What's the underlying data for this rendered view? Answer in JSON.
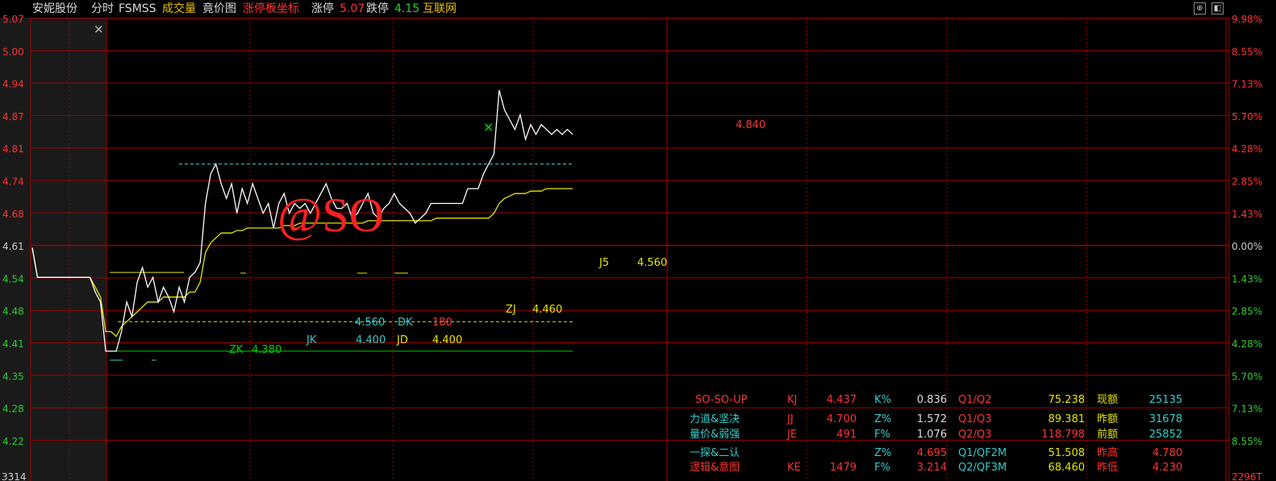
{
  "header": {
    "stock_name": "安妮股份",
    "mode": "分时",
    "indicator": "FSMSS",
    "volume": "成交量",
    "auction": "竟价图",
    "limit_axis": "涨停板坐标",
    "limit_up_label": "涨停",
    "limit_up_value": "5.07",
    "limit_down_label": "跌停",
    "limit_down_value": "4.15",
    "source": "互联网"
  },
  "colors": {
    "up": "#ff3333",
    "down": "#33cc33",
    "grid": "#a00000",
    "price_line": "#ffffff",
    "avg_line": "#e6e600",
    "cyan": "#33cccc",
    "yellow": "#e6e600",
    "green": "#00dd00"
  },
  "left_axis": [
    "5.07",
    "5.00",
    "4.94",
    "4.87",
    "4.81",
    "4.74",
    "4.68",
    "4.61",
    "4.54",
    "4.48",
    "4.41",
    "4.35",
    "4.28",
    "4.22"
  ],
  "right_axis": [
    "9.98%",
    "8.55%",
    "7.13%",
    "5.70%",
    "4.28%",
    "2.85%",
    "1.43%",
    "0.00%",
    "1.43%",
    "2.85%",
    "4.28%",
    "5.70%",
    "7.13%",
    "8.55%"
  ],
  "bottom_left_value": "3314",
  "bottom_right_value": "2296T",
  "watermark": "@SO",
  "annotations": {
    "price_mark": "4.840",
    "j5": "J5",
    "j5_value": "4.560",
    "zj": "ZJ",
    "zj_value": "4.460",
    "dk_left": "4.560",
    "dk": "DK",
    "dk_value": "180",
    "jk": "JK",
    "jk_value": "4.400",
    "jd": "JD",
    "jd_value": "4.400",
    "zk": "ZK",
    "zk_value": "4.380",
    "close_x": "×"
  },
  "stats": {
    "rows": [
      {
        "name": "SO-SO-UP",
        "k1": "KJ",
        "v1": "4.437",
        "k2": "K%",
        "v2": "0.836",
        "k3": "Q1/Q2",
        "v3": "75.238",
        "k4": "现额",
        "v4": "25135"
      },
      {
        "name": "力道&坚决",
        "k1": "JJ",
        "v1": "4.700",
        "k2": "Z%",
        "v2": "1.572",
        "k3": "Q1/Q3",
        "v3": "89.381",
        "k4": "昨额",
        "v4": "31678"
      },
      {
        "name": "量价&弱强",
        "k1": "JE",
        "v1": "491",
        "k2": "F%",
        "v2": "1.076",
        "k3": "Q2/Q3",
        "v3": "118.798",
        "k4": "前额",
        "v4": "25852"
      },
      {
        "name": "一探&二认",
        "k1": "",
        "v1": "",
        "k2": "Z%",
        "v2": "4.695",
        "k3": "Q1/QF2M",
        "v3": "51.508",
        "k4": "昨高",
        "v4": "4.780"
      },
      {
        "name": "逻辑&意图",
        "k1": "KE",
        "v1": "1479",
        "k2": "F%",
        "v2": "3.214",
        "k3": "Q2/QF3M",
        "v3": "68.460",
        "k4": "昨低",
        "v4": "4.230"
      }
    ]
  },
  "chart_data": {
    "type": "line",
    "series": [
      {
        "values": [
          4.61,
          4.55,
          4.55,
          4.55,
          4.55,
          4.55,
          4.55,
          4.55,
          4.55,
          4.55,
          4.55,
          4.55,
          4.52,
          4.5,
          4.4,
          4.4,
          4.4,
          4.44,
          4.5,
          4.47,
          4.54,
          4.57,
          4.53,
          4.55,
          4.5,
          4.53,
          4.51,
          4.48,
          4.53,
          4.5,
          4.55,
          4.56,
          4.58,
          4.7,
          4.76,
          4.78,
          4.74,
          4.71,
          4.74,
          4.68,
          4.73,
          4.7,
          4.74,
          4.71,
          4.68,
          4.7,
          4.65,
          4.7,
          4.72,
          4.68,
          4.7,
          4.69,
          4.7,
          4.68,
          4.7,
          4.72,
          4.74,
          4.71,
          4.69,
          4.69,
          4.7,
          4.67,
          4.68,
          4.7,
          4.72,
          4.68,
          4.67,
          4.69,
          4.7,
          4.72,
          4.7,
          4.69,
          4.68,
          4.66,
          4.67,
          4.68,
          4.7,
          4.7,
          4.7,
          4.7,
          4.7,
          4.7,
          4.7,
          4.73,
          4.73,
          4.73,
          4.76,
          4.78,
          4.8,
          4.93,
          4.89,
          4.87,
          4.85,
          4.88,
          4.83,
          4.86,
          4.84,
          4.86,
          4.85,
          4.84,
          4.85,
          4.84,
          4.85,
          4.84
        ]
      },
      {
        "values": [
          4.61,
          4.55,
          4.55,
          4.55,
          4.55,
          4.55,
          4.55,
          4.55,
          4.55,
          4.55,
          4.55,
          4.55,
          4.53,
          4.51,
          4.44,
          4.44,
          4.43,
          4.45,
          4.46,
          4.47,
          4.48,
          4.49,
          4.5,
          4.5,
          4.5,
          4.51,
          4.51,
          4.51,
          4.51,
          4.51,
          4.52,
          4.52,
          4.54,
          4.6,
          4.62,
          4.63,
          4.64,
          4.64,
          4.64,
          4.645,
          4.645,
          4.65,
          4.65,
          4.65,
          4.65,
          4.65,
          4.65,
          4.65,
          4.655,
          4.655,
          4.655,
          4.66,
          4.66,
          4.66,
          4.66,
          4.66,
          4.66,
          4.66,
          4.66,
          4.66,
          4.66,
          4.66,
          4.66,
          4.66,
          4.665,
          4.665,
          4.665,
          4.665,
          4.665,
          4.665,
          4.665,
          4.665,
          4.665,
          4.665,
          4.665,
          4.665,
          4.665,
          4.67,
          4.67,
          4.67,
          4.67,
          4.67,
          4.67,
          4.67,
          4.67,
          4.67,
          4.67,
          4.67,
          4.68,
          4.7,
          4.71,
          4.715,
          4.72,
          4.72,
          4.72,
          4.725,
          4.725,
          4.725,
          4.73,
          4.73,
          4.73,
          4.73,
          4.73,
          4.73
        ]
      }
    ],
    "levels": {
      "cyan_dashed": 4.78,
      "yellow_solid": 4.56,
      "yellow_dashed": 4.46,
      "green_solid": 4.4
    },
    "ylim": [
      4.15,
      5.07
    ]
  }
}
